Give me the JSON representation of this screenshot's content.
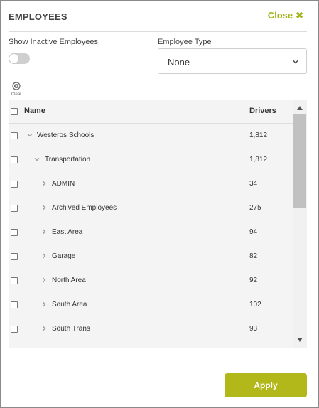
{
  "header": {
    "title": "EMPLOYEES",
    "close_label": "Close",
    "close_icon": "close-x-icon"
  },
  "filters": {
    "inactive_label": "Show Inactive Employees",
    "inactive_enabled": false,
    "type_label": "Employee Type",
    "type_value": "None"
  },
  "toolbar": {
    "clear_label": "Clear",
    "clear_icon": "clear-circle-icon"
  },
  "table": {
    "columns": [
      "Name",
      "Drivers"
    ],
    "rows": [
      {
        "name": "Westeros Schools",
        "drivers": "1,812",
        "level": 0,
        "expanded": true
      },
      {
        "name": "Transportation",
        "drivers": "1,812",
        "level": 1,
        "expanded": true
      },
      {
        "name": "ADMIN",
        "drivers": "34",
        "level": 2,
        "expanded": false
      },
      {
        "name": "Archived Employees",
        "drivers": "275",
        "level": 2,
        "expanded": false
      },
      {
        "name": "East Area",
        "drivers": "94",
        "level": 2,
        "expanded": false
      },
      {
        "name": "Garage",
        "drivers": "82",
        "level": 2,
        "expanded": false
      },
      {
        "name": "North Area",
        "drivers": "92",
        "level": 2,
        "expanded": false
      },
      {
        "name": "South Area",
        "drivers": "102",
        "level": 2,
        "expanded": false
      },
      {
        "name": "South Trans",
        "drivers": "93",
        "level": 2,
        "expanded": false
      }
    ]
  },
  "footer": {
    "apply_label": "Apply"
  },
  "colors": {
    "accent": "#b2b71a",
    "close_text": "#a8b520"
  }
}
